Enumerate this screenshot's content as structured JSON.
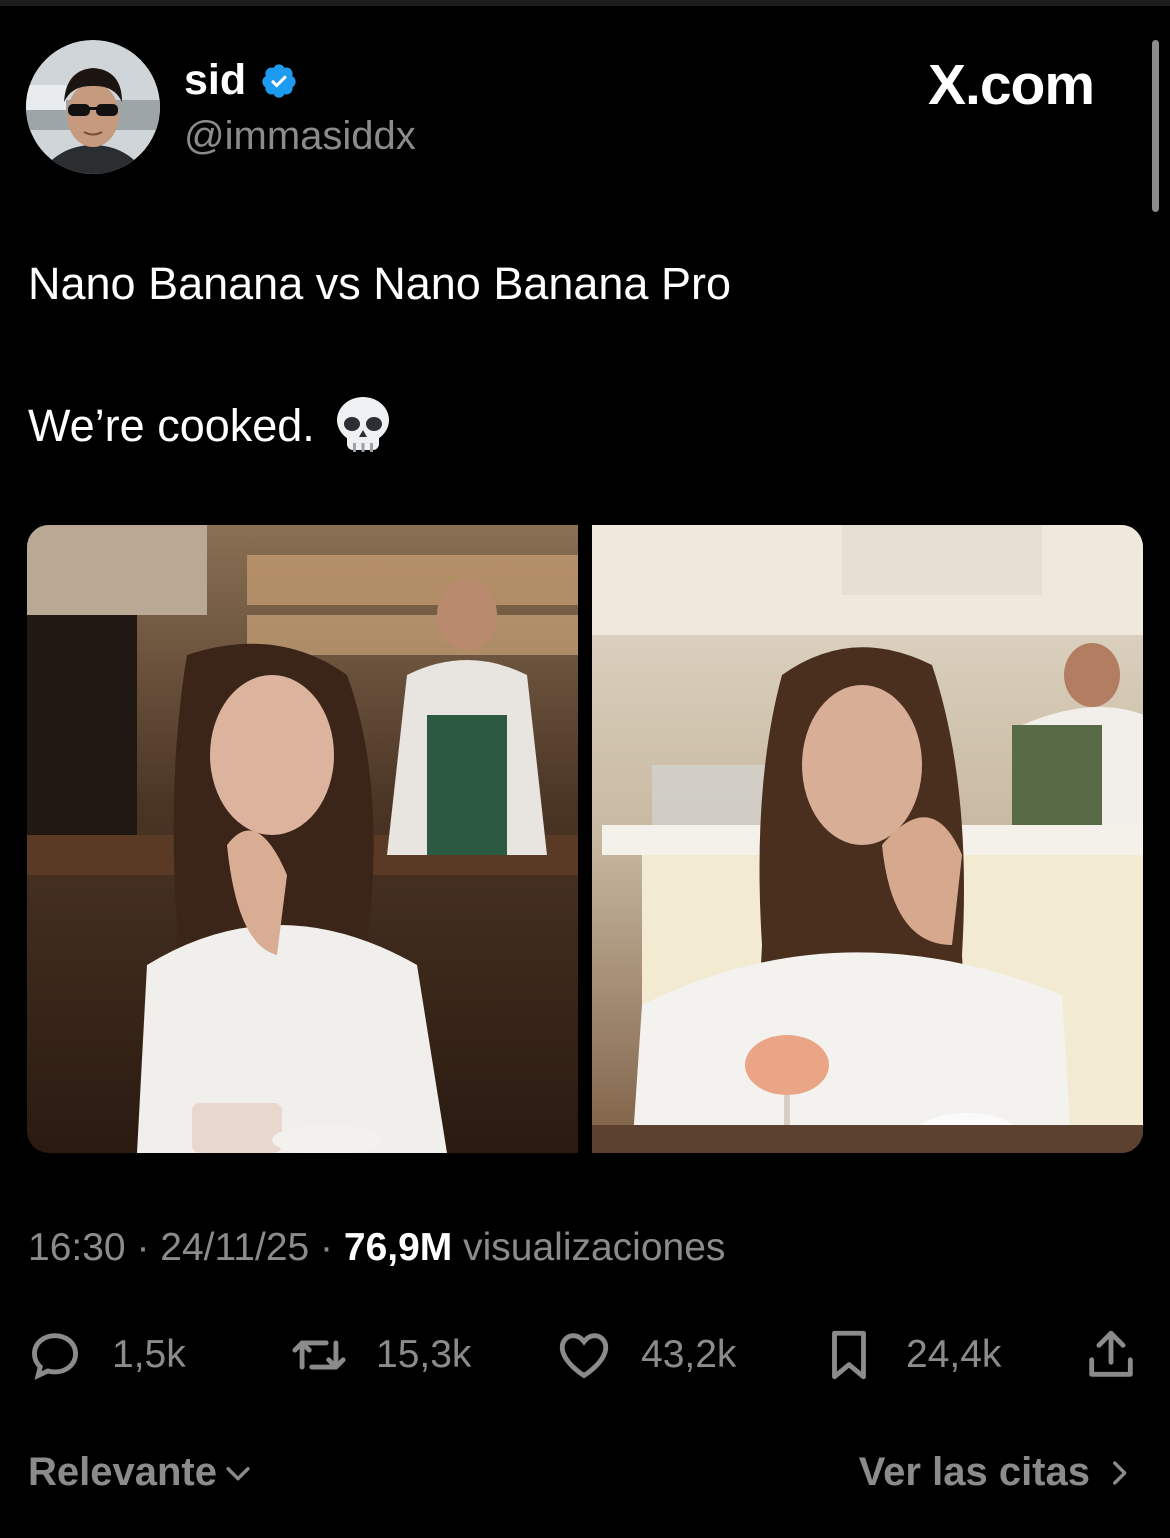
{
  "author": {
    "name": "sid",
    "handle": "@immasiddx",
    "verified": true,
    "verified_color": "#1d9bf0"
  },
  "brand": "X.com",
  "tweet": {
    "line1": "Nano Banana vs Nano Banana Pro",
    "line2": "We’re cooked."
  },
  "meta": {
    "time": "16:30",
    "sep1": " · ",
    "date": "24/11/25",
    "sep2": " · ",
    "views": "76,9M",
    "views_label": " visualizaciones"
  },
  "actions": {
    "replies": "1,5k",
    "reposts": "15,3k",
    "likes": "43,2k",
    "bookmarks": "24,4k"
  },
  "footer": {
    "sort_label": "Relevante",
    "quotes_label": "Ver las citas"
  },
  "icons": [
    "verified-badge-icon",
    "skull-emoji-icon",
    "reply-icon",
    "repost-icon",
    "like-icon",
    "bookmark-icon",
    "share-icon",
    "chevron-down-icon",
    "chevron-right-icon"
  ]
}
